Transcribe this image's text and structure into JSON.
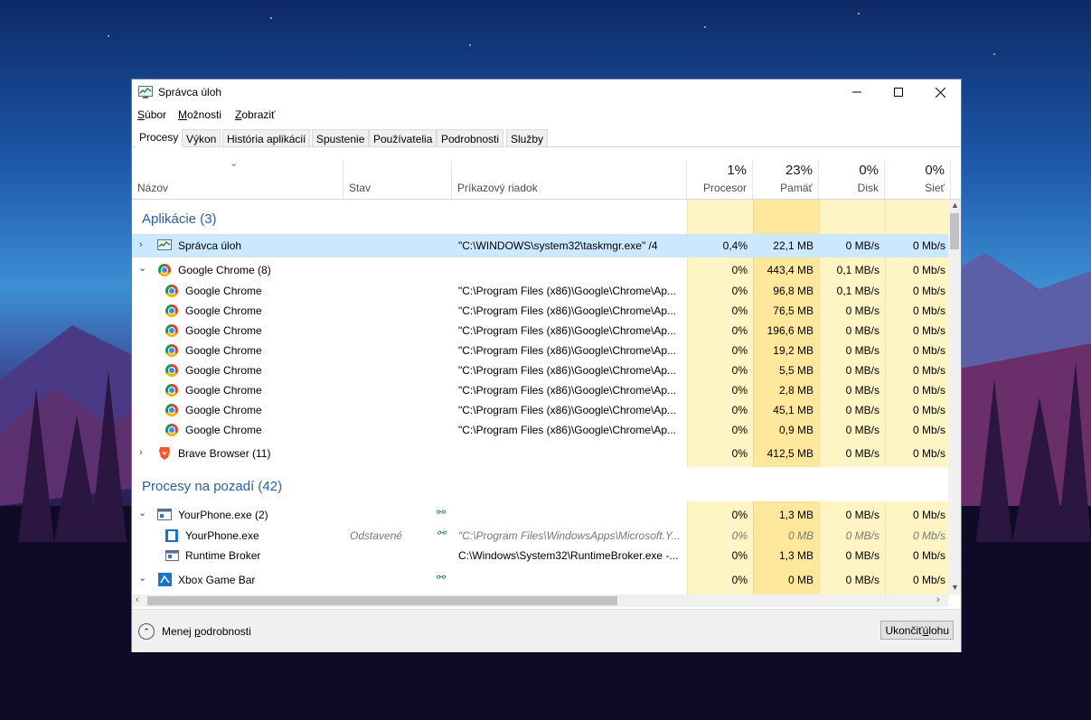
{
  "window": {
    "title": "Správca úloh"
  },
  "menu": [
    {
      "accel": "S",
      "rest": "úbor"
    },
    {
      "accel": "M",
      "rest": "ožnosti"
    },
    {
      "accel": "Z",
      "rest": "obraziť"
    }
  ],
  "tabs": [
    "Procesy",
    "Výkon",
    "História aplikácií",
    "Spustenie",
    "Používatelia",
    "Podrobnosti",
    "Služby"
  ],
  "columns": {
    "name": "Názov",
    "status": "Stav",
    "cmdline": "Príkazový riadok",
    "cpu": "Procesor",
    "cpu_pct": "1%",
    "memory": "Pamäť",
    "memory_pct": "23%",
    "disk": "Disk",
    "disk_pct": "0%",
    "network": "Sieť",
    "network_pct": "0%"
  },
  "groups": {
    "apps": "Aplikácie (3)",
    "background": "Procesy na pozadí (42)"
  },
  "rows": [
    {
      "name": "Správca úloh",
      "status": "",
      "cmd": "\"C:\\WINDOWS\\system32\\taskmgr.exe\" /4",
      "cpu": "0,4%",
      "mem": "22,1 MB",
      "disk": "0 MB/s",
      "net": "0 Mb/s"
    },
    {
      "name": "Google Chrome (8)",
      "status": "",
      "cmd": "",
      "cpu": "0%",
      "mem": "443,4 MB",
      "disk": "0,1 MB/s",
      "net": "0 Mb/s"
    },
    {
      "name": "Google Chrome",
      "cmd": "\"C:\\Program Files (x86)\\Google\\Chrome\\Ap...",
      "cpu": "0%",
      "mem": "96,8 MB",
      "disk": "0,1 MB/s",
      "net": "0 Mb/s"
    },
    {
      "name": "Google Chrome",
      "cmd": "\"C:\\Program Files (x86)\\Google\\Chrome\\Ap...",
      "cpu": "0%",
      "mem": "76,5 MB",
      "disk": "0 MB/s",
      "net": "0 Mb/s"
    },
    {
      "name": "Google Chrome",
      "cmd": "\"C:\\Program Files (x86)\\Google\\Chrome\\Ap...",
      "cpu": "0%",
      "mem": "196,6 MB",
      "disk": "0 MB/s",
      "net": "0 Mb/s"
    },
    {
      "name": "Google Chrome",
      "cmd": "\"C:\\Program Files (x86)\\Google\\Chrome\\Ap...",
      "cpu": "0%",
      "mem": "19,2 MB",
      "disk": "0 MB/s",
      "net": "0 Mb/s"
    },
    {
      "name": "Google Chrome",
      "cmd": "\"C:\\Program Files (x86)\\Google\\Chrome\\Ap...",
      "cpu": "0%",
      "mem": "5,5 MB",
      "disk": "0 MB/s",
      "net": "0 Mb/s"
    },
    {
      "name": "Google Chrome",
      "cmd": "\"C:\\Program Files (x86)\\Google\\Chrome\\Ap...",
      "cpu": "0%",
      "mem": "2,8 MB",
      "disk": "0 MB/s",
      "net": "0 Mb/s"
    },
    {
      "name": "Google Chrome",
      "cmd": "\"C:\\Program Files (x86)\\Google\\Chrome\\Ap...",
      "cpu": "0%",
      "mem": "45,1 MB",
      "disk": "0 MB/s",
      "net": "0 Mb/s"
    },
    {
      "name": "Google Chrome",
      "cmd": "\"C:\\Program Files (x86)\\Google\\Chrome\\Ap...",
      "cpu": "0%",
      "mem": "0,9 MB",
      "disk": "0 MB/s",
      "net": "0 Mb/s"
    },
    {
      "name": "Brave Browser (11)",
      "cmd": "",
      "cpu": "0%",
      "mem": "412,5 MB",
      "disk": "0 MB/s",
      "net": "0 Mb/s"
    },
    {
      "name": "YourPhone.exe (2)",
      "cmd": "",
      "cpu": "0%",
      "mem": "1,3 MB",
      "disk": "0 MB/s",
      "net": "0 Mb/s"
    },
    {
      "name": "YourPhone.exe",
      "status": "Odstavené",
      "cmd": "\"C:\\Program Files\\WindowsApps\\Microsoft.Y...",
      "cpu": "0%",
      "mem": "0 MB",
      "disk": "0 MB/s",
      "net": "0 Mb/s"
    },
    {
      "name": "Runtime Broker",
      "cmd": "C:\\Windows\\System32\\RuntimeBroker.exe -...",
      "cpu": "0%",
      "mem": "1,3 MB",
      "disk": "0 MB/s",
      "net": "0 Mb/s"
    },
    {
      "name": "Xbox Game Bar",
      "cmd": "",
      "cpu": "0%",
      "mem": "0 MB",
      "disk": "0 MB/s",
      "net": "0 Mb/s"
    }
  ],
  "footer": {
    "less_pre": "Menej ",
    "less_accel": "p",
    "less_post": "odrobnosti",
    "end_pre": "Ukončiť ",
    "end_accel": "ú",
    "end_post": "lohu"
  },
  "colors": {
    "selected": "#cce8ff",
    "heat_light": "#fff4c4",
    "heat_mid": "#ffe79b",
    "group_title": "#2a5fa8"
  }
}
